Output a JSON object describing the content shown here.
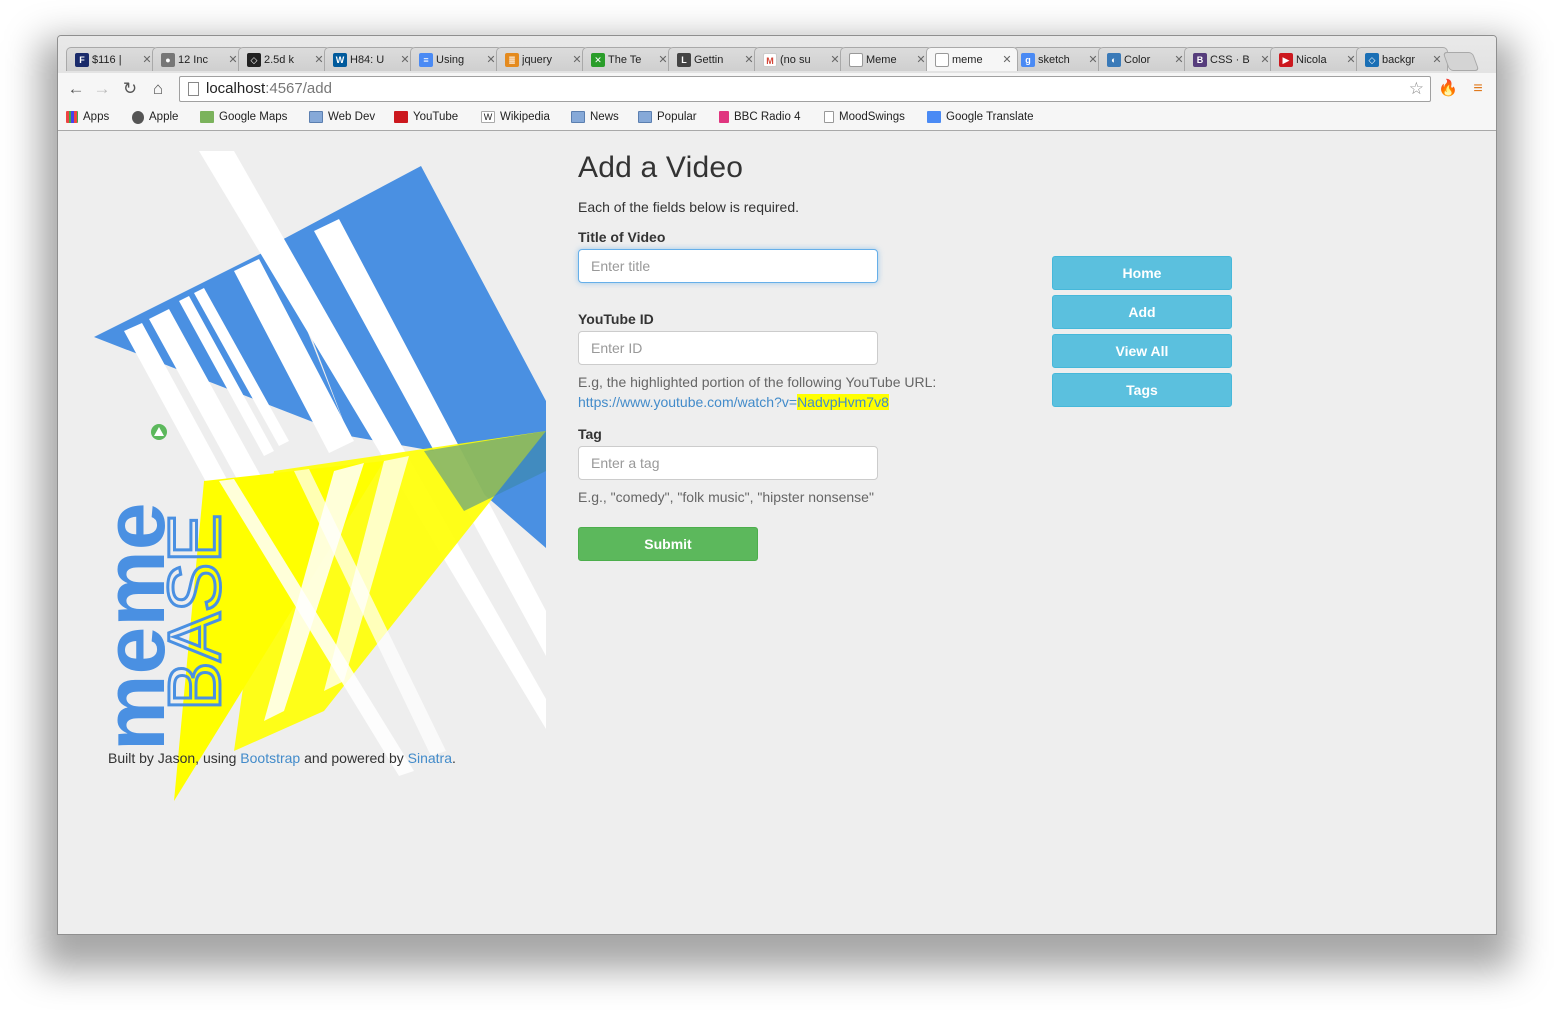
{
  "browser": {
    "tabs": [
      {
        "label": "$116 |",
        "icon": "f-icon",
        "color": "#1a2b6b"
      },
      {
        "label": "12 Inc",
        "icon": "github-icon",
        "color": "#555555"
      },
      {
        "label": "2.5d k",
        "icon": "codepen-icon",
        "color": "#222222"
      },
      {
        "label": "H84: U",
        "icon": "w3c-icon",
        "color": "#005a9c"
      },
      {
        "label": "Using",
        "icon": "docs-icon",
        "color": "#4a8af4"
      },
      {
        "label": "jquery",
        "icon": "stackoverflow-icon",
        "color": "#e48a1e"
      },
      {
        "label": "The Te",
        "icon": "x-green-icon",
        "color": "#2a9d2a"
      },
      {
        "label": "Gettin",
        "icon": "less-icon",
        "color": "#444444"
      },
      {
        "label": "(no su",
        "icon": "gmail-icon",
        "color": "#d44638"
      },
      {
        "label": "Meme",
        "icon": "page-icon",
        "color": "#ffffff"
      },
      {
        "label": "meme",
        "icon": "page-icon",
        "color": "#ffffff",
        "active": true
      },
      {
        "label": "sketch",
        "icon": "google-icon",
        "color": "#4a8af4"
      },
      {
        "label": "Color",
        "icon": "color-icon",
        "color": "#3a7ab8"
      },
      {
        "label": "CSS · B",
        "icon": "bootstrap-icon",
        "color": "#563d7c"
      },
      {
        "label": "Nicola",
        "icon": "youtube-icon",
        "color": "#cc181e"
      },
      {
        "label": "backgr",
        "icon": "codepen-icon",
        "color": "#1a6fb5"
      }
    ],
    "address": {
      "host": "localhost",
      "path": ":4567/add"
    },
    "bookmarks": [
      {
        "label": "Apps",
        "icon": "apps-grid-icon"
      },
      {
        "label": "Apple",
        "icon": "apple-icon"
      },
      {
        "label": "Google Maps",
        "icon": "maps-icon"
      },
      {
        "label": "Web Dev",
        "icon": "folder-icon"
      },
      {
        "label": "YouTube",
        "icon": "youtube-icon"
      },
      {
        "label": "Wikipedia",
        "icon": "wikipedia-icon"
      },
      {
        "label": "News",
        "icon": "folder-icon"
      },
      {
        "label": "Popular",
        "icon": "folder-icon"
      },
      {
        "label": "BBC Radio 4",
        "icon": "bbc-radio-icon"
      },
      {
        "label": "MoodSwings",
        "icon": "page-icon"
      },
      {
        "label": "Google Translate",
        "icon": "translate-icon"
      }
    ]
  },
  "page": {
    "title": "Add a Video",
    "intro": "Each of the fields below is required.",
    "fields": {
      "title_label": "Title of Video",
      "title_placeholder": "Enter title",
      "youtube_label": "YouTube ID",
      "youtube_placeholder": "Enter ID",
      "youtube_help": "E.g, the highlighted portion of the following YouTube URL:",
      "youtube_url_prefix": "https://www.youtube.com/watch?v=",
      "youtube_url_id": "NadvpHvm7v8",
      "tag_label": "Tag",
      "tag_placeholder": "Enter a tag",
      "tag_help": "E.g., \"comedy\", \"folk music\", \"hipster nonsense\""
    },
    "submit_label": "Submit",
    "nav": [
      "Home",
      "Add",
      "View All",
      "Tags"
    ],
    "logo": {
      "word1": "meme",
      "word2": "BASE"
    },
    "footer": {
      "prefix": "Built by Jason, using ",
      "link1": "Bootstrap",
      "middle": " and powered by ",
      "link2": "Sinatra",
      "suffix": "."
    },
    "colors": {
      "brand_blue": "#4a90e2",
      "brand_yellow": "#ffff00",
      "success": "#5cb85c",
      "info": "#5bc0de",
      "link": "#428bca"
    }
  }
}
